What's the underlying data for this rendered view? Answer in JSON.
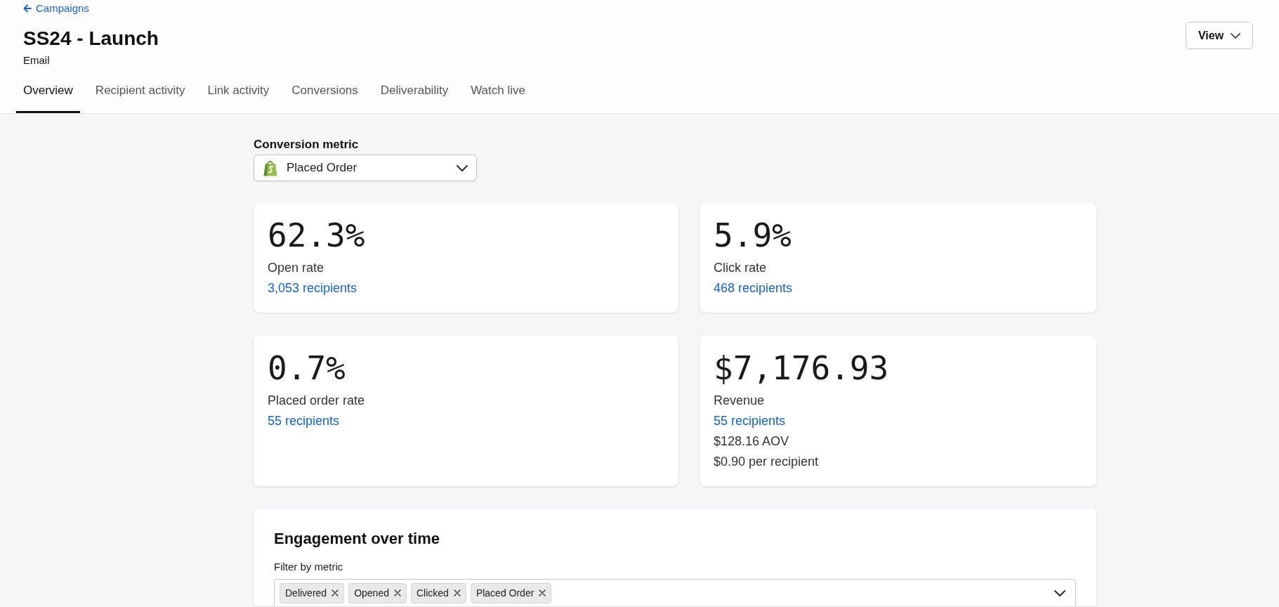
{
  "back_link": {
    "label": "Campaigns"
  },
  "page": {
    "title": "SS24 - Launch",
    "subtitle": "Email"
  },
  "view_button": {
    "label": "View"
  },
  "tabs": [
    {
      "label": "Overview",
      "selected": true
    },
    {
      "label": "Recipient activity",
      "selected": false
    },
    {
      "label": "Link activity",
      "selected": false
    },
    {
      "label": "Conversions",
      "selected": false
    },
    {
      "label": "Deliverability",
      "selected": false
    },
    {
      "label": "Watch live",
      "selected": false
    }
  ],
  "conversion_metric": {
    "label": "Conversion metric",
    "value": "Placed Order"
  },
  "metric_cards": [
    {
      "value": "62.3%",
      "label": "Open rate",
      "link": "3,053 recipients"
    },
    {
      "value": "5.9%",
      "label": "Click rate",
      "link": "468 recipients"
    },
    {
      "value": "0.7%",
      "label": "Placed order rate",
      "link": "55 recipients"
    },
    {
      "value": "$7,176.93",
      "label": "Revenue",
      "link": "55 recipients",
      "details": [
        "$128.16 AOV",
        "$0.90 per recipient"
      ]
    }
  ],
  "engagement": {
    "title": "Engagement over time",
    "filter_label": "Filter by metric",
    "filters": [
      "Delivered",
      "Opened",
      "Clicked",
      "Placed Order"
    ]
  }
}
